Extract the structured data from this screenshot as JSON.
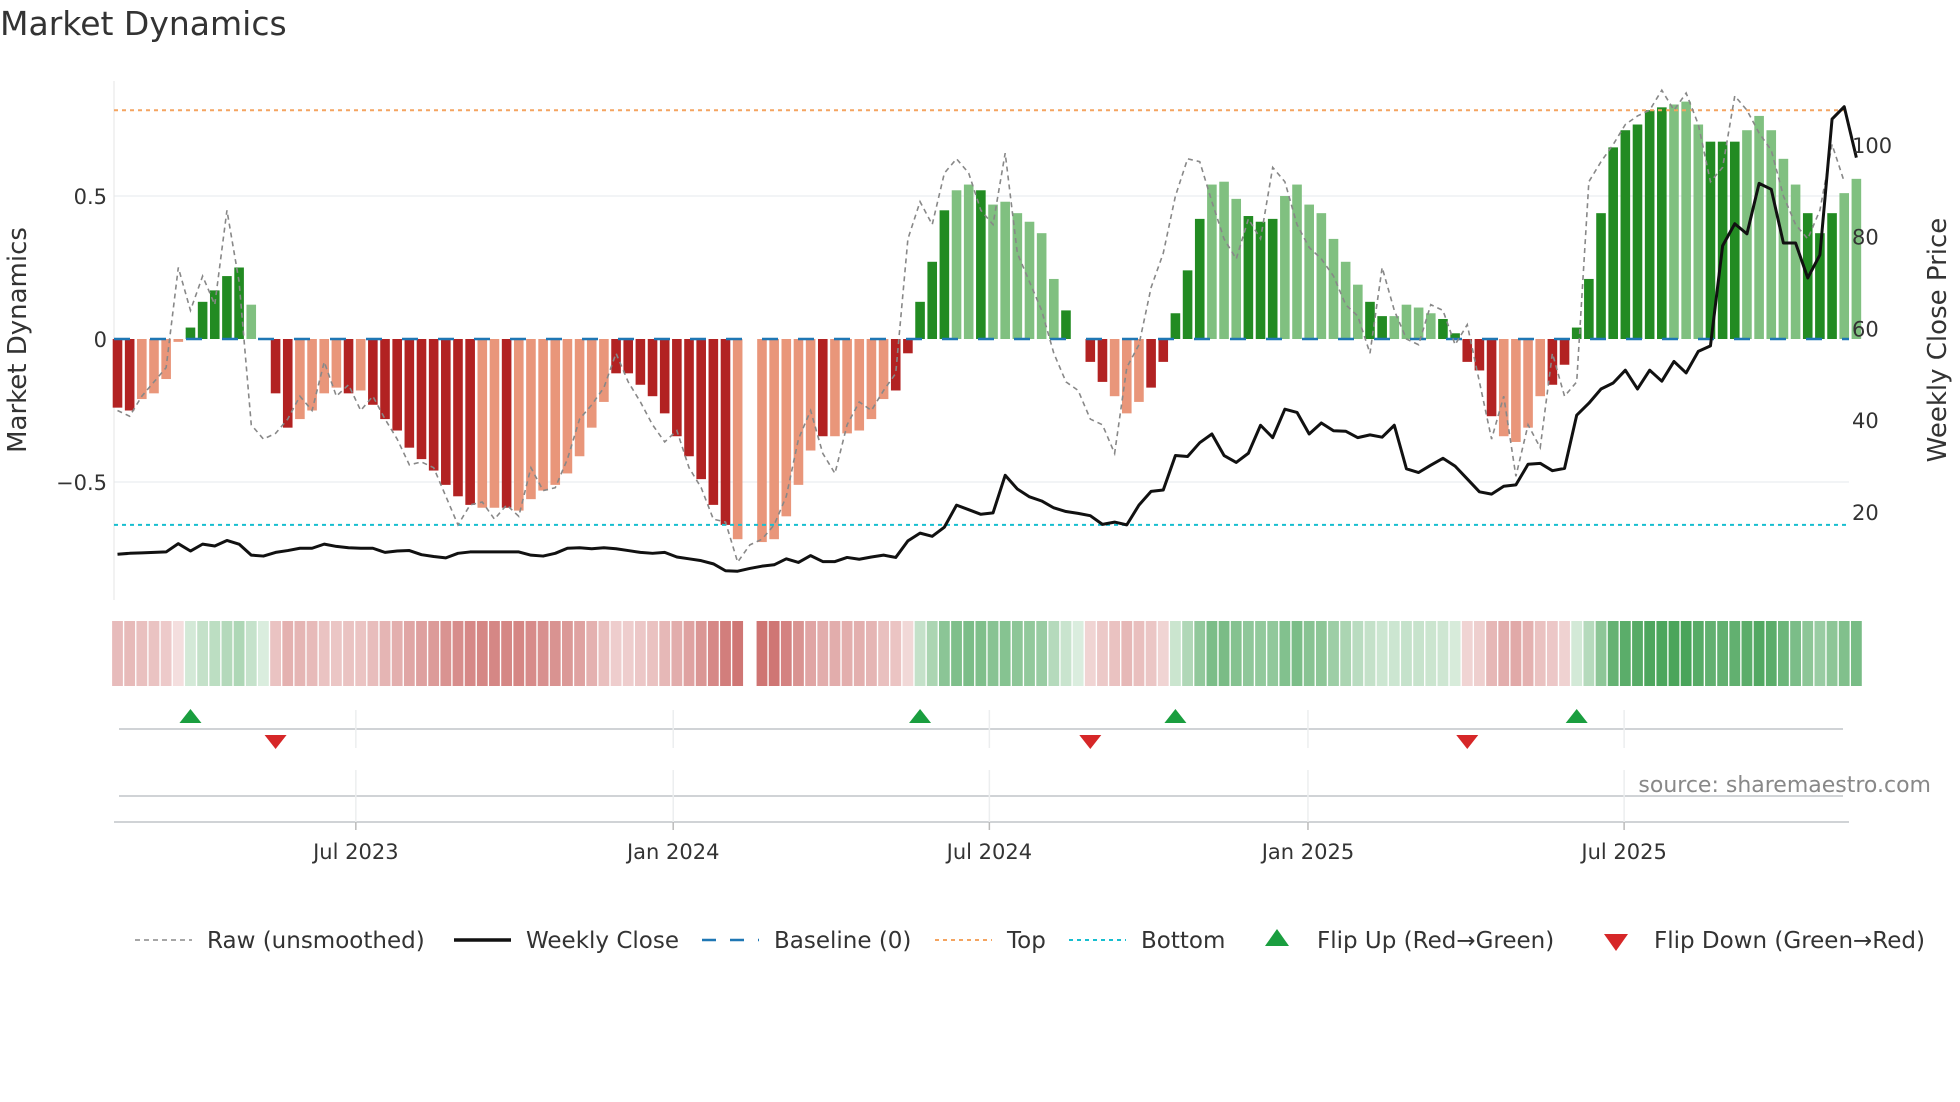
{
  "title": "Market Dynamics",
  "source": "source: sharemaestro.com",
  "colors": {
    "strong_green": "#228b22",
    "weak_green": "#80c080",
    "strong_red": "#b22222",
    "weak_red": "#e9967a",
    "baseline": "#1f77b4",
    "top": "#f4a460",
    "bottom": "#17becf",
    "raw": "#888888",
    "close": "#111111",
    "flip_up": "#1a9e3f",
    "flip_down": "#d62728"
  },
  "legend": [
    {
      "key": "raw",
      "label": "Raw (unsmoothed)"
    },
    {
      "key": "close",
      "label": "Weekly Close"
    },
    {
      "key": "baseline",
      "label": "Baseline (0)"
    },
    {
      "key": "top",
      "label": "Top"
    },
    {
      "key": "bottom",
      "label": "Bottom"
    },
    {
      "key": "flip_up",
      "label": "Flip Up (Red→Green)"
    },
    {
      "key": "flip_down",
      "label": "Flip Down (Green→Red)"
    }
  ],
  "chart_data": {
    "type": "bar",
    "title": "Market Dynamics",
    "ylabel": "Market Dynamics",
    "y2label": "Weekly Close Price",
    "ylim": [
      -0.92,
      0.92
    ],
    "y2lim": [
      0,
      120
    ],
    "yticks": [
      {
        "v": 0.5,
        "label": "0.5"
      },
      {
        "v": 0,
        "label": "0"
      },
      {
        "v": -0.5,
        "label": "−0.5"
      }
    ],
    "y2ticks": [
      {
        "v": 100,
        "label": "100"
      },
      {
        "v": 80,
        "label": "80"
      },
      {
        "v": 60,
        "label": "60"
      },
      {
        "v": 40,
        "label": "40"
      },
      {
        "v": 20,
        "label": "20"
      }
    ],
    "xticks": [
      {
        "week": 19.6,
        "label": "Jul 2023"
      },
      {
        "week": 45.7,
        "label": "Jan 2024"
      },
      {
        "week": 71.7,
        "label": "Jul 2024"
      },
      {
        "week": 97.9,
        "label": "Jan 2025"
      },
      {
        "week": 123.9,
        "label": "Jul 2025"
      }
    ],
    "top_line": 0.8,
    "bottom_line": -0.65,
    "baseline": 0,
    "dynamics": [
      -0.24,
      -0.25,
      -0.21,
      -0.19,
      -0.14,
      -0.01,
      0.04,
      0.13,
      0.17,
      0.22,
      0.25,
      0.12,
      0,
      -0.19,
      -0.31,
      -0.28,
      -0.25,
      -0.19,
      -0.17,
      -0.19,
      -0.18,
      -0.23,
      -0.28,
      -0.32,
      -0.38,
      -0.42,
      -0.46,
      -0.51,
      -0.55,
      -0.58,
      -0.59,
      -0.59,
      -0.59,
      -0.6,
      -0.56,
      -0.53,
      -0.51,
      -0.47,
      -0.41,
      -0.31,
      -0.22,
      -0.12,
      -0.12,
      -0.16,
      -0.2,
      -0.26,
      -0.34,
      -0.41,
      -0.49,
      -0.58,
      -0.65,
      -0.7,
      0,
      -0.71,
      -0.7,
      -0.62,
      -0.51,
      -0.39,
      -0.34,
      -0.34,
      -0.33,
      -0.32,
      -0.28,
      -0.21,
      -0.18,
      -0.05,
      0.13,
      0.27,
      0.45,
      0.52,
      0.54,
      0.52,
      0.47,
      0.48,
      0.44,
      0.41,
      0.37,
      0.21,
      0.1,
      0,
      -0.08,
      -0.15,
      -0.2,
      -0.26,
      -0.22,
      -0.17,
      -0.08,
      0.09,
      0.24,
      0.42,
      0.54,
      0.55,
      0.49,
      0.43,
      0.41,
      0.42,
      0.5,
      0.54,
      0.47,
      0.44,
      0.35,
      0.27,
      0.19,
      0.13,
      0.08,
      0.08,
      0.12,
      0.11,
      0.09,
      0.07,
      0.02,
      -0.08,
      -0.11,
      -0.27,
      -0.34,
      -0.36,
      -0.31,
      -0.2,
      -0.16,
      -0.09,
      0.04,
      0.21,
      0.44,
      0.67,
      0.73,
      0.75,
      0.8,
      0.81,
      0.82,
      0.83,
      0.75,
      0.69,
      0.69,
      0.69,
      0.73,
      0.78,
      0.73,
      0.63,
      0.54,
      0.44,
      0.37,
      0.44,
      0.51,
      0.56
    ],
    "strength": "SSWWWWSSSSSWWSSWWWWSWSSSSSSSSSWWSWWWWWWWWSSSSSSSSSSWSWWWWWSWWWWWSSSSSWWSWWWWWWSSSSWWWSSSSSWWWSSSWWWWWWWSSWWWWSSSSSWWWWSSSSSSSSSSWWWSSSWWWWWSSS",
    "raw": [
      -0.25,
      -0.27,
      -0.2,
      -0.15,
      -0.1,
      0.25,
      0.1,
      0.22,
      0.12,
      0.45,
      0.2,
      -0.3,
      -0.35,
      -0.33,
      -0.28,
      -0.2,
      -0.25,
      -0.08,
      -0.2,
      -0.16,
      -0.25,
      -0.2,
      -0.28,
      -0.35,
      -0.44,
      -0.43,
      -0.45,
      -0.55,
      -0.65,
      -0.58,
      -0.57,
      -0.63,
      -0.58,
      -0.62,
      -0.45,
      -0.53,
      -0.52,
      -0.42,
      -0.28,
      -0.23,
      -0.17,
      -0.05,
      -0.15,
      -0.22,
      -0.3,
      -0.36,
      -0.32,
      -0.45,
      -0.52,
      -0.63,
      -0.64,
      -0.78,
      -0.72,
      -0.7,
      -0.65,
      -0.55,
      -0.35,
      -0.25,
      -0.4,
      -0.47,
      -0.3,
      -0.22,
      -0.25,
      -0.18,
      -0.12,
      0.35,
      0.48,
      0.4,
      0.58,
      0.63,
      0.58,
      0.45,
      0.4,
      0.65,
      0.3,
      0.2,
      0.1,
      -0.05,
      -0.15,
      -0.18,
      -0.28,
      -0.3,
      -0.4,
      -0.1,
      -0.02,
      0.18,
      0.3,
      0.5,
      0.63,
      0.62,
      0.48,
      0.35,
      0.28,
      0.42,
      0.35,
      0.6,
      0.55,
      0.4,
      0.32,
      0.28,
      0.22,
      0.12,
      0.08,
      -0.05,
      0.25,
      0.1,
      0.0,
      -0.02,
      0.12,
      0.1,
      -0.02,
      0.05,
      -0.15,
      -0.35,
      -0.2,
      -0.48,
      -0.3,
      -0.38,
      -0.05,
      -0.2,
      -0.15,
      0.55,
      0.62,
      0.68,
      0.75,
      0.78,
      0.8,
      0.87,
      0.8,
      0.86,
      0.75,
      0.55,
      0.6,
      0.85,
      0.8,
      0.72,
      0.66,
      0.5,
      0.4,
      0.35,
      0.45,
      0.68,
      0.55
    ],
    "weekly_close": [
      10.8,
      11.0,
      11.1,
      11.2,
      11.3,
      13.1,
      11.5,
      13.0,
      12.6,
      13.8,
      13.0,
      10.6,
      10.4,
      11.2,
      11.6,
      12.1,
      12.1,
      13.0,
      12.5,
      12.2,
      12.1,
      12.1,
      11.2,
      11.5,
      11.6,
      10.7,
      10.3,
      10.0,
      11.0,
      11.3,
      11.3,
      11.3,
      11.3,
      11.3,
      10.6,
      10.4,
      11.0,
      12.1,
      12.2,
      12.0,
      12.2,
      12.0,
      11.6,
      11.2,
      11.0,
      11.2,
      10.2,
      9.8,
      9.4,
      8.7,
      7.2,
      7.1,
      7.7,
      8.2,
      8.5,
      9.8,
      9.0,
      10.5,
      9.2,
      9.2,
      10.1,
      9.7,
      10.2,
      10.6,
      10.1,
      13.7,
      15.4,
      14.7,
      16.7,
      21.5,
      20.5,
      19.5,
      19.8,
      28.0,
      25.0,
      23.3,
      22.4,
      20.9,
      20.1,
      19.7,
      19.2,
      17.3,
      17.8,
      17.2,
      21.5,
      24.5,
      24.8,
      32.3,
      32.1,
      35.1,
      37.0,
      32.3,
      30.8,
      32.8,
      38.9,
      36.2,
      42.4,
      41.7,
      37.0,
      39.4,
      37.7,
      37.6,
      36.2,
      36.8,
      36.3,
      38.9,
      29.4,
      28.6,
      30.2,
      31.7,
      30.0,
      27.2,
      24.4,
      23.9,
      25.6,
      25.9,
      30.4,
      30.6,
      29.0,
      29.5,
      41.1,
      43.7,
      46.8,
      48.1,
      50.9,
      46.8,
      50.9,
      48.5,
      52.8,
      50.3,
      55.0,
      56.2,
      78.0,
      82.8,
      80.6,
      91.6,
      90.3,
      78.6,
      78.6,
      71.0,
      76.0,
      105.6,
      108.3,
      97.2
    ],
    "flip_up_weeks": [
      6,
      66,
      87,
      120
    ],
    "flip_down_weeks": [
      13,
      80,
      111
    ],
    "legend_position": "bottom"
  }
}
